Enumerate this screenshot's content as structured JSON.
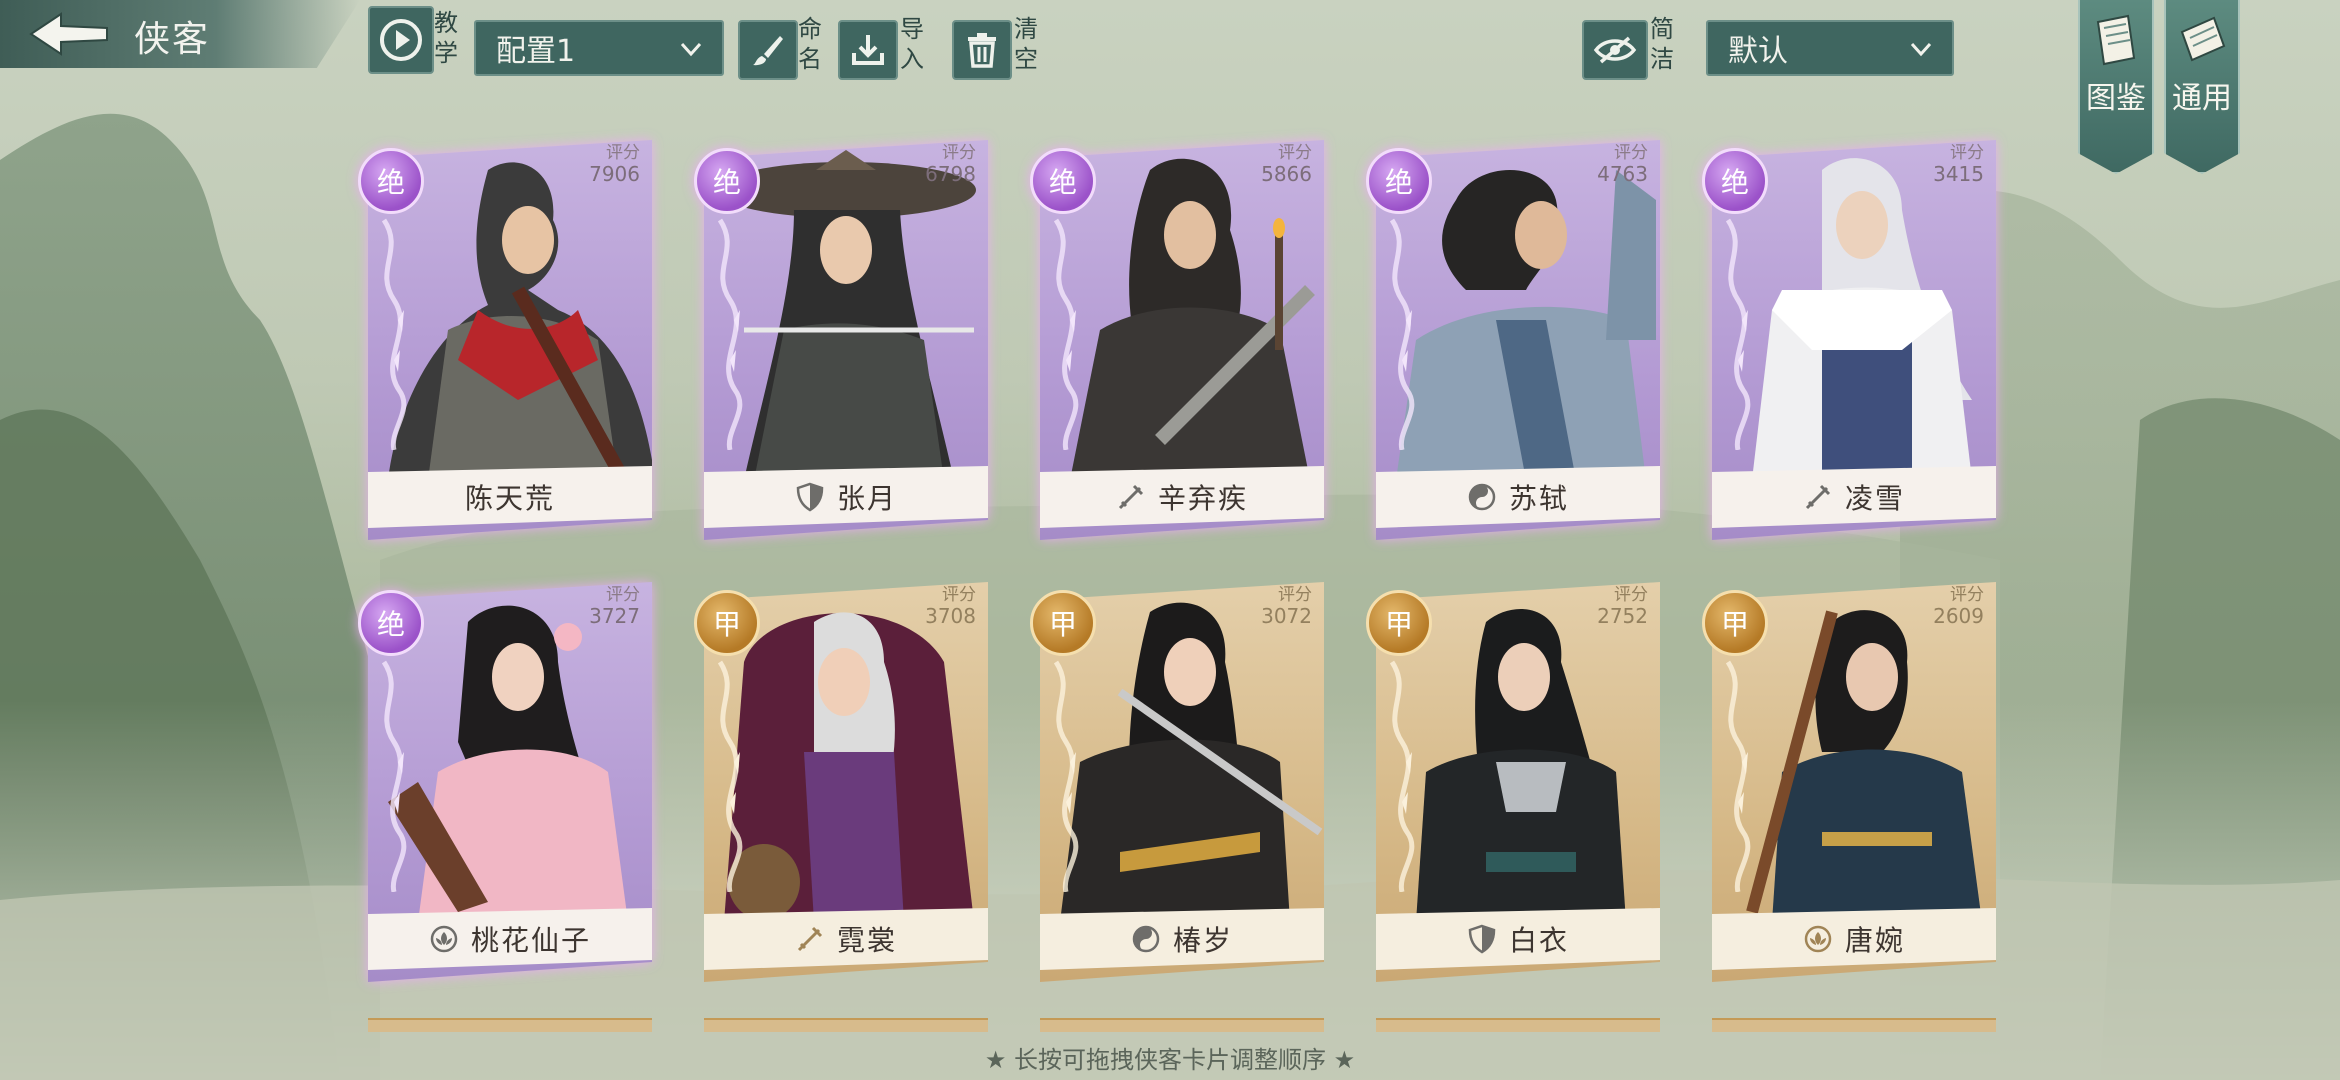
{
  "header": {
    "title": "侠客",
    "tutorial_label": "教学",
    "config_select": "配置1",
    "rename_label": "命名",
    "import_label": "导入",
    "clear_label": "清空",
    "simple_label": "简洁",
    "sort_select": "默认",
    "codex_label": "图鉴",
    "general_label": "通用"
  },
  "score_label": "评分",
  "cards": [
    {
      "name": "陈天荒",
      "rarity": "绝",
      "score": "7906",
      "class_icon": "none"
    },
    {
      "name": "张月",
      "rarity": "绝",
      "score": "6798",
      "class_icon": "shield-icon"
    },
    {
      "name": "辛弃疾",
      "rarity": "绝",
      "score": "5866",
      "class_icon": "sword-icon"
    },
    {
      "name": "苏轼",
      "rarity": "绝",
      "score": "4763",
      "class_icon": "yinyang-icon"
    },
    {
      "name": "凌雪",
      "rarity": "绝",
      "score": "3415",
      "class_icon": "sword-icon"
    },
    {
      "name": "桃花仙子",
      "rarity": "绝",
      "score": "3727",
      "class_icon": "lotus-icon"
    },
    {
      "name": "霓裳",
      "rarity": "甲",
      "score": "3708",
      "class_icon": "sword-icon"
    },
    {
      "name": "椿岁",
      "rarity": "甲",
      "score": "3072",
      "class_icon": "yinyang-icon"
    },
    {
      "name": "白衣",
      "rarity": "甲",
      "score": "2752",
      "class_icon": "shield-icon"
    },
    {
      "name": "唐婉",
      "rarity": "甲",
      "score": "2609",
      "class_icon": "lotus-icon"
    }
  ],
  "footer": {
    "hint": "★ 长按可拖拽侠客卡片调整顺序 ★"
  },
  "colors": {
    "jue": "#b39ad3",
    "jia": "#d6b988",
    "toolbar": "#3f6660"
  }
}
